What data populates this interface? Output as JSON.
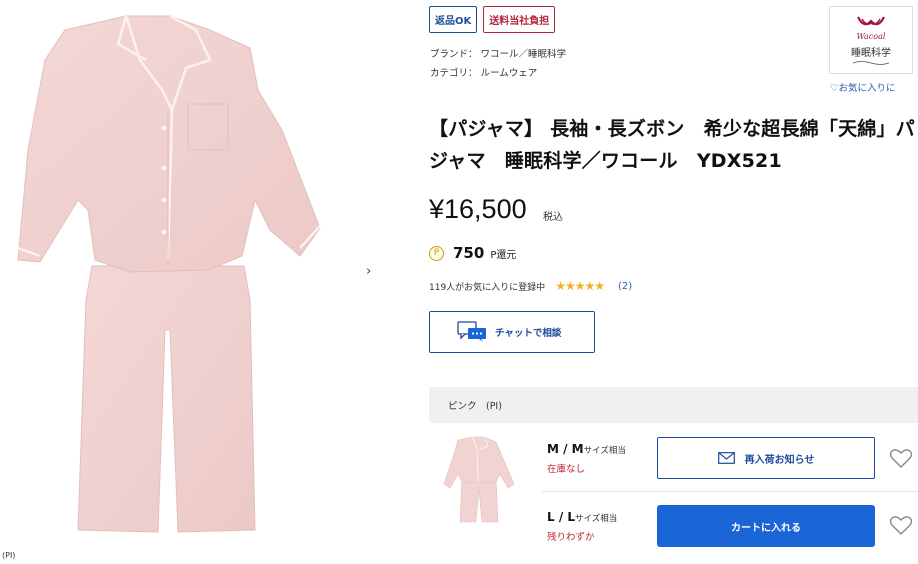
{
  "image": {
    "caption": "(PI)",
    "next_arrow": "›"
  },
  "badges": {
    "returnable": "返品OK",
    "shipping": "送料当社負担"
  },
  "meta": {
    "brand": "ブランド： ワコール／睡眠科学",
    "category": "カテゴリ： ルームウェア"
  },
  "brand_logo": {
    "wordmark": "Wacoal",
    "label": "睡眠科学"
  },
  "favorite": {
    "icon": "heart-outline-icon",
    "label": "♡お気に入りに"
  },
  "product": {
    "title": "【パジャマ】 長袖・長ズボン　希少な超長綿「天綿」パジャマ　睡眠科学／ワコール　YDX521",
    "price": "¥16,500",
    "tax_label": "税込",
    "points_icon": "P",
    "points_value": "750",
    "points_label": "P還元",
    "favorites_count_text": "119人がお気に入りに登録中",
    "stars": "★★★★★",
    "review_count": "(2)"
  },
  "chat": {
    "label": "チャットで相談"
  },
  "color": {
    "label": "ピンク　(PI)"
  },
  "sizes": [
    {
      "size": "M / M",
      "suffix": "サイズ相当",
      "stock": "在庫なし",
      "action": "再入荷お知らせ"
    },
    {
      "size": "L / L",
      "suffix": "サイズ相当",
      "stock": "残りわずか",
      "action": "カートに入れる"
    }
  ],
  "colors": {
    "primary_blue": "#1a66d6",
    "navy": "#1c4a9c",
    "stock_red": "#c0282e",
    "pajama_pink": "#f1d3d2"
  }
}
